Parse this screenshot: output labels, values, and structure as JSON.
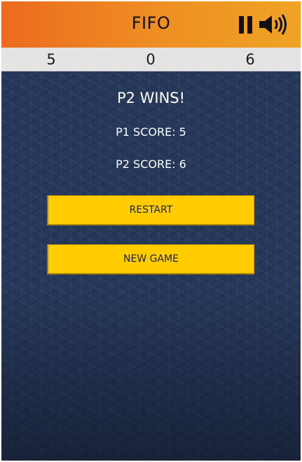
{
  "header": {
    "title": "FIFO",
    "pause_icon": "pause-icon",
    "sound_icon": "speaker-volume-icon",
    "gradient_start": "#ec6b1f",
    "gradient_end": "#efa424"
  },
  "scoreboard": {
    "p1": "5",
    "middle": "0",
    "p2": "6"
  },
  "result": {
    "winner": "P2 WINS!",
    "p1_score": "P1 SCORE: 5",
    "p2_score": "P2 SCORE: 6"
  },
  "buttons": {
    "restart": "RESTART",
    "new_game": "NEW GAME",
    "color": "#ffcc00"
  },
  "board": {
    "background": "#26385a"
  }
}
